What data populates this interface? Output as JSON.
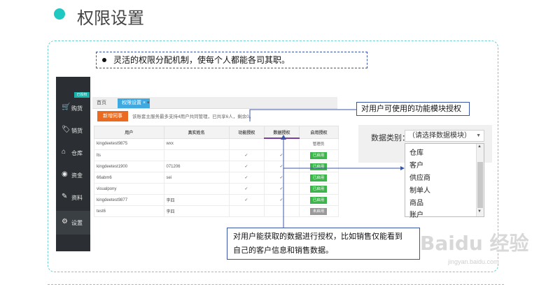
{
  "title": "权限设置",
  "intro_note": "灵活的权限分配机制，使每个人都能各司其职。",
  "sidebar": {
    "badge": "已授权",
    "items": [
      {
        "icon": "cart-icon",
        "glyph": "🛒",
        "label": "购货"
      },
      {
        "icon": "tag-icon",
        "glyph": "🏷",
        "label": "销货"
      },
      {
        "icon": "warehouse-icon",
        "glyph": "⌂",
        "label": "仓库"
      },
      {
        "icon": "coin-icon",
        "glyph": "◉",
        "label": "资金"
      },
      {
        "icon": "pencil-icon",
        "glyph": "✎",
        "label": "资料"
      },
      {
        "icon": "gear-icon",
        "glyph": "⚙",
        "label": "设置"
      }
    ]
  },
  "tabs": [
    {
      "label": "首页"
    },
    {
      "label": "权限设置 ×"
    },
    {
      "label": "▾"
    }
  ],
  "toolbar": {
    "new_button": "新增同事",
    "info": "该账套主服务最多支持4用户共同管理，已共享6人，剩余0。"
  },
  "table": {
    "headers": [
      "用户",
      "真实姓名",
      "功能授权",
      "数据授权",
      "启用授权"
    ],
    "rows": [
      {
        "user": "kingdeetest9875",
        "name": "wxx",
        "func": "",
        "data": "",
        "status": "管理员",
        "status_type": "text"
      },
      {
        "user": "lts",
        "name": "",
        "func": "✓",
        "data": "✓",
        "status": "已启用",
        "status_type": "green"
      },
      {
        "user": "kingdeetest1900",
        "name": "071206",
        "func": "✓",
        "data": "✓",
        "status": "已启用",
        "status_type": "green"
      },
      {
        "user": "66abm6",
        "name": "sei",
        "func": "✓",
        "data": "✓",
        "status": "已启用",
        "status_type": "green"
      },
      {
        "user": "visualpony",
        "name": "",
        "func": "✓",
        "data": "✓",
        "status": "已启用",
        "status_type": "green"
      },
      {
        "user": "kingdeetest9877",
        "name": "李四",
        "func": "✓",
        "data": "✓",
        "status": "已启用",
        "status_type": "green"
      },
      {
        "user": "test6",
        "name": "李四",
        "func": "",
        "data": "",
        "status": "未启用",
        "status_type": "gray"
      }
    ]
  },
  "callout_func": "对用户可使用的功能模块授权",
  "callout_data": {
    "line1": "对用户能获取的数据进行授权，比如销售仅能看到",
    "line2": "自己的客户信息和销售数据。"
  },
  "data_category": {
    "label": "数据类别：",
    "selected": "（请选择数据模块）",
    "options": [
      "仓库",
      "客户",
      "供应商",
      "制单人",
      "商品",
      "账户"
    ]
  },
  "watermark": {
    "main": "Baidu 经验",
    "sub": "jingyan.baidu.com"
  },
  "colors": {
    "accent": "#1fc8c0",
    "tab_active": "#3fa9e0",
    "new_button": "#ea6b1f",
    "enabled": "#3cb54a",
    "callout_border": "#3a55a8"
  }
}
